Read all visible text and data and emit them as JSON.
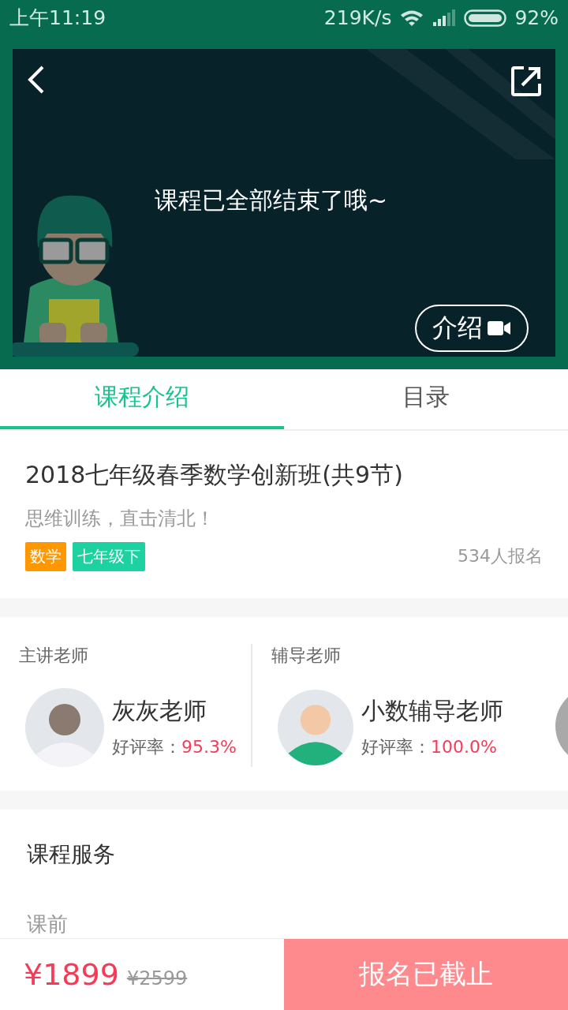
{
  "status_bar": {
    "time": "上午11:19",
    "speed": "219K/s",
    "battery": "92%"
  },
  "video": {
    "message": "课程已全部结束了哦~",
    "intro_button": "介绍"
  },
  "tabs": [
    {
      "label": "课程介绍",
      "selected": true
    },
    {
      "label": "目录",
      "selected": false
    }
  ],
  "course": {
    "title": "2018七年级春季数学创新班(共9节)",
    "subtitle": "思维训练，直击清北！",
    "tags": [
      {
        "label": "数学",
        "color": "#ff9800"
      },
      {
        "label": "七年级下",
        "color": "#1dd1a1"
      }
    ],
    "enrolled": "534人报名"
  },
  "teachers": [
    {
      "role": "主讲老师",
      "name": "灰灰老师",
      "rating_label": "好评率：",
      "rating": "95.3%"
    },
    {
      "role": "辅导老师",
      "name": "小数辅导老师",
      "rating_label": "好评率：",
      "rating": "100.0%"
    }
  ],
  "services": {
    "title": "课程服务",
    "section": "课前"
  },
  "bottom_bar": {
    "price": "¥1899",
    "original_price": "¥2599",
    "button": "报名已截止",
    "button_disabled": true
  }
}
